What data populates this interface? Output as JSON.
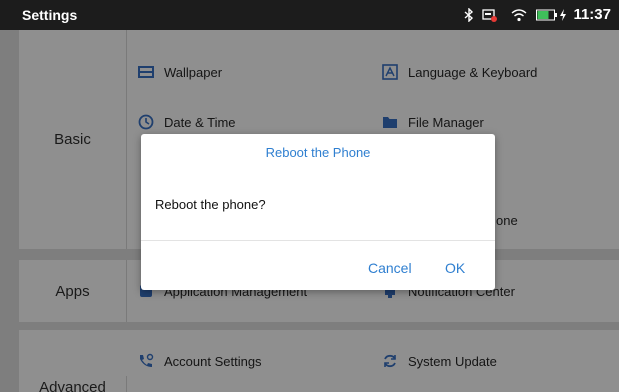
{
  "status_bar": {
    "title": "Settings",
    "time": "11:37",
    "battery": "58%",
    "icons": [
      "bluetooth-icon",
      "notification-icon",
      "wifi-icon",
      "battery-icon",
      "charging-icon"
    ]
  },
  "settings": {
    "categories": [
      {
        "label": "Basic",
        "items": [
          "Wallpaper",
          "Language & Keyboard",
          "Date & Time",
          "File Manager",
          "one"
        ]
      },
      {
        "label": "Apps",
        "items": [
          "Application Management",
          "Notification Center"
        ]
      },
      {
        "label": "Advanced",
        "items": [
          "Account Settings",
          "System Update"
        ]
      }
    ]
  },
  "dialog": {
    "title": "Reboot the Phone",
    "message": "Reboot the phone?",
    "cancel_label": "Cancel",
    "ok_label": "OK"
  },
  "colors": {
    "accent": "#2f7fd0",
    "status_bar": "#1c1c1c",
    "dim_background": "#7e7e7e",
    "battery": "#3fbf5a"
  }
}
